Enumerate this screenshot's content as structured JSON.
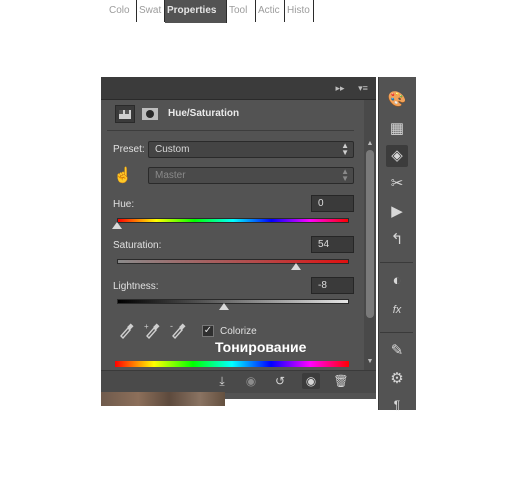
{
  "tabs": [
    {
      "label": "Colo",
      "active": false
    },
    {
      "label": "Swat",
      "active": false
    },
    {
      "label": "Properties",
      "active": true
    },
    {
      "label": "Tool",
      "active": false
    },
    {
      "label": "Actic",
      "active": false
    },
    {
      "label": "Histo",
      "active": false
    }
  ],
  "tab_overflow": "▸▸",
  "panel_menu": "▾≡",
  "header": {
    "title": "Hue/Saturation"
  },
  "preset": {
    "label": "Preset:",
    "value": "Custom"
  },
  "channel": {
    "value": "Master"
  },
  "hue": {
    "label": "Hue:",
    "value": "0",
    "slider_level": 0.0
  },
  "saturation": {
    "label": "Saturation:",
    "value": "54",
    "slider_level": 0.77
  },
  "lightness": {
    "label": "Lightness:",
    "value": "-8",
    "slider_level": 0.46
  },
  "colorize": {
    "label": "Colorize",
    "checked": true
  },
  "annotation": "Тонирование",
  "colors": {
    "panel": "#535353",
    "tabbar": "#3b3b3b",
    "annotation": "#ffffff"
  },
  "bottom_icons": [
    "clip-to-layer-icon",
    "view-previous-icon",
    "reset-icon",
    "visibility-eye-icon",
    "delete-trash-icon"
  ],
  "toolbar_icons": [
    "palette-icon",
    "grid-swatches-icon",
    "adjustments-cube-icon",
    "tools-icon",
    "play-action-icon",
    "history-icon",
    "color-circle-icon",
    "fx-styles-icon",
    "brush-presets-icon",
    "clone-source-icon",
    "paragraph-icon"
  ]
}
